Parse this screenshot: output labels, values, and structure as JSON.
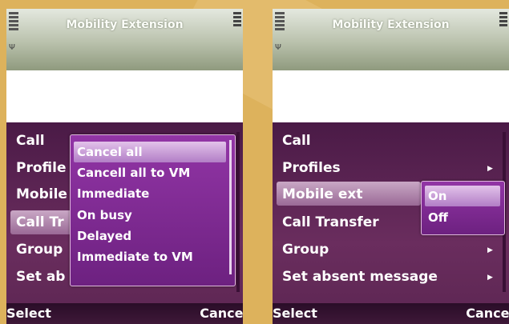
{
  "left_screen": {
    "title": "Mobility Extension",
    "menu_items": [
      "Call",
      "Profile",
      "Mobile",
      "Call Tr",
      "Group",
      "Set ab"
    ],
    "popup_options": [
      "Cancel all",
      "Cancell all to VM",
      "Immediate",
      "On busy",
      "Delayed",
      "Immediate to VM"
    ],
    "selected_option": "Cancel all",
    "softkeys": {
      "left": "Select",
      "right": "Cancel"
    }
  },
  "right_screen": {
    "title": "Mobility Extension",
    "menu_items": [
      "Call",
      "Profiles",
      "Mobile ext",
      "Call Transfer",
      "Group",
      "Set absent message"
    ],
    "selected_item": "Mobile ext",
    "popup_options": [
      "On",
      "Off"
    ],
    "selected_option": "On",
    "softkeys": {
      "left": "Select",
      "right": "Cancel"
    }
  },
  "icons": [
    "signal-icon",
    "antenna-icon",
    "battery-icon",
    "submenu-arrow-icon"
  ],
  "colors": {
    "background": "#ddb25c",
    "menu": "#5c2652",
    "popup": "#7d2890",
    "status_bar": "#b9c1ac"
  }
}
